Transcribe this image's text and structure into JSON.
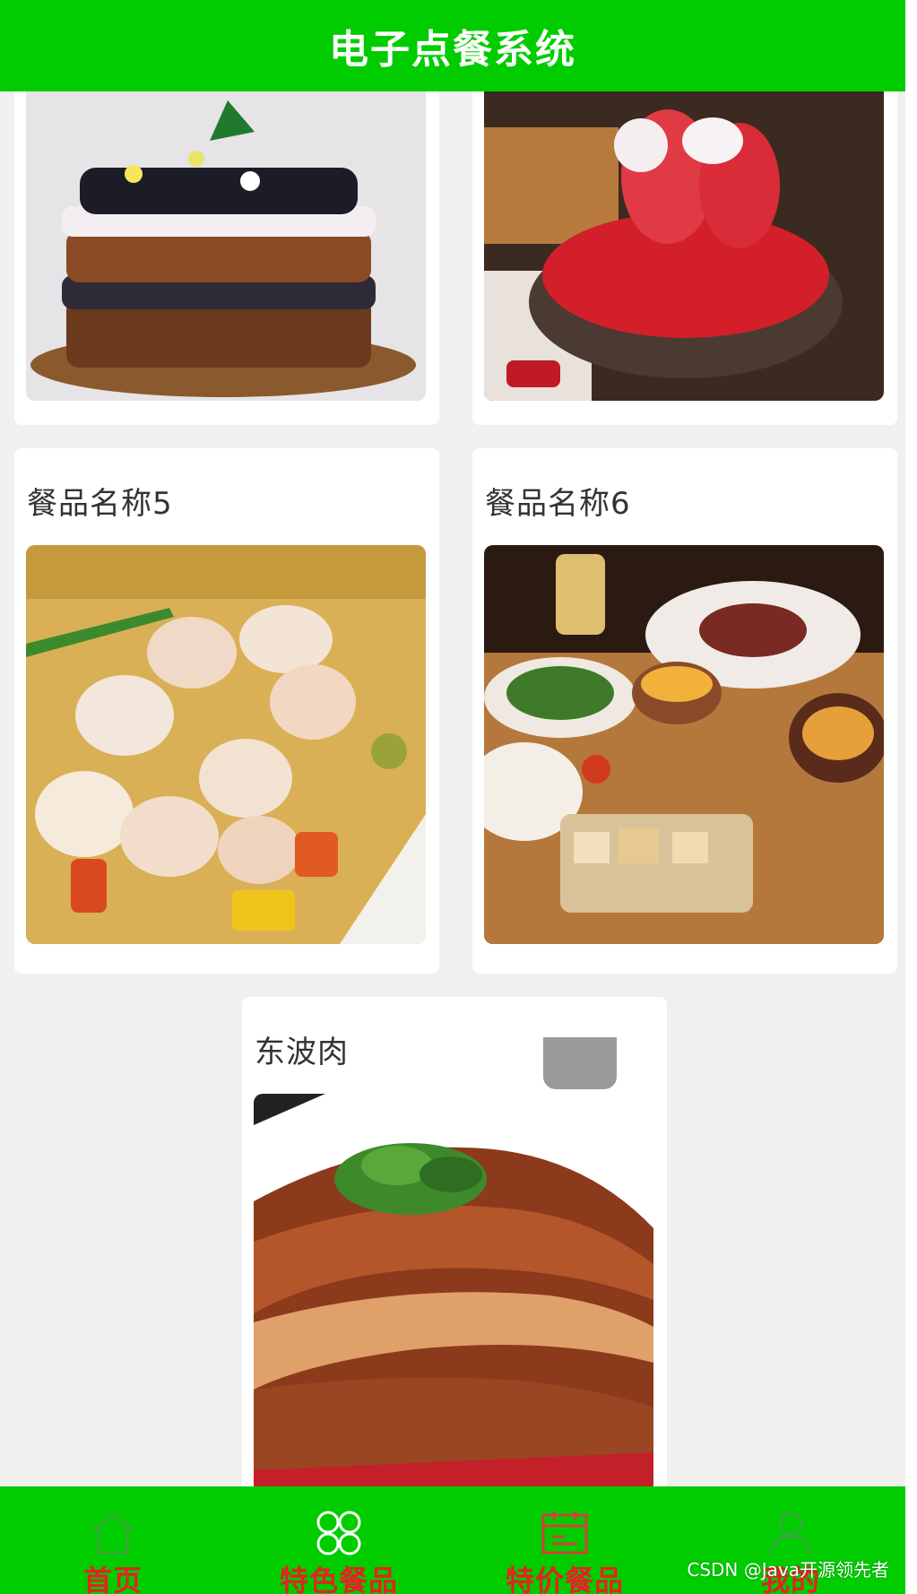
{
  "header": {
    "title": "电子点餐系统"
  },
  "dishes": [
    {
      "name": "",
      "photo": "berry-layer-cake"
    },
    {
      "name": "",
      "photo": "strawberry-shaved-ice"
    },
    {
      "name": "餐品名称5",
      "photo": "shrimp-curry-tray"
    },
    {
      "name": "餐品名称6",
      "photo": "western-dinner-table"
    },
    {
      "name": "东波肉",
      "photo": "braised-pork-belly"
    }
  ],
  "nav": [
    {
      "label": "首页",
      "icon": "home-icon"
    },
    {
      "label": "特色餐品",
      "icon": "clover-icon"
    },
    {
      "label": "特价餐品",
      "icon": "calendar-icon"
    },
    {
      "label": "我的",
      "icon": "user-icon"
    }
  ],
  "watermark": "CSDN @Java开源领先者",
  "colors": {
    "brand_green": "#00cc00",
    "nav_label_red": "#e52222",
    "page_bg": "#f0f0f0",
    "card_bg": "#ffffff"
  }
}
